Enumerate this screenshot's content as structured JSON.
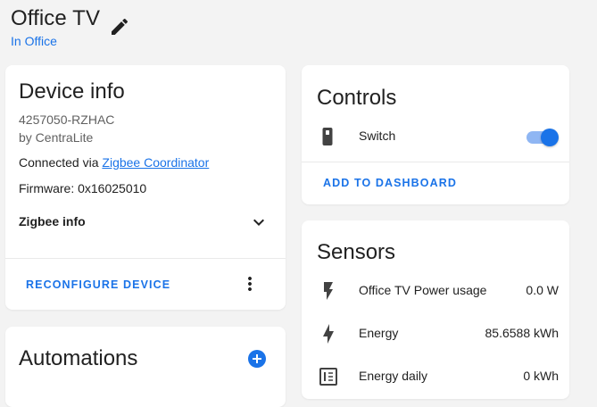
{
  "header": {
    "title": "Office TV",
    "area": "In Office"
  },
  "device_info": {
    "title": "Device info",
    "model": "4257050-RZHAC",
    "manufacturer": "by CentraLite",
    "connected_prefix": "Connected via ",
    "connected_link": "Zigbee Coordinator",
    "firmware": "Firmware: 0x16025010",
    "zigbee_info": "Zigbee info",
    "reconfigure": "RECONFIGURE DEVICE"
  },
  "automations": {
    "title": "Automations"
  },
  "controls": {
    "title": "Controls",
    "switch_label": "Switch",
    "switch_on": true,
    "add_to_dashboard": "ADD TO DASHBOARD"
  },
  "sensors": {
    "title": "Sensors",
    "items": [
      {
        "label": "Office TV Power usage",
        "value": "0.0 W",
        "icon": "flash-icon"
      },
      {
        "label": "Energy",
        "value": "85.6588 kWh",
        "icon": "lightning-icon"
      },
      {
        "label": "Energy daily",
        "value": "0 kWh",
        "icon": "meter-icon"
      }
    ]
  },
  "colors": {
    "accent": "#1a73e8",
    "background": "#f3f3f3",
    "card": "#ffffff",
    "icon": "#424242"
  }
}
